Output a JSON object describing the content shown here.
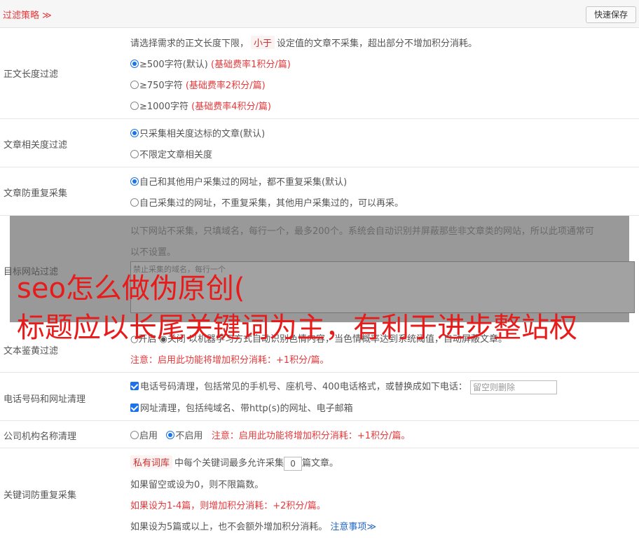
{
  "header": {
    "title": "过滤策略 ≫",
    "save_label": "快速保存"
  },
  "length_filter": {
    "label": "正文长度过滤",
    "desc_pre": "请选择需求的正文长度下限，",
    "desc_tag": "小于",
    "desc_post": "设定值的文章不采集，超出部分不增加积分消耗。",
    "opt1": "≥500字符(默认)",
    "opt1_note": "(基础费率1积分/篇)",
    "opt2": "≥750字符",
    "opt2_note": "(基础费率2积分/篇)",
    "opt3": "≥1000字符",
    "opt3_note": "(基础费率4积分/篇)"
  },
  "relevance": {
    "label": "文章相关度过滤",
    "opt1": "只采集相关度达标的文章(默认)",
    "opt2": "不限定文章相关度"
  },
  "dedupe": {
    "label": "文章防重复采集",
    "opt1": "自己和其他用户采集过的网址，都不重复采集(默认)",
    "opt2": "自己采集过的网址，不重复采集，其他用户采集过的，可以再采。"
  },
  "target_site": {
    "label": "目标网站过滤",
    "desc1": "以下网站不采集，只填域名，每行一个，最多200个。系统会自动识别并屏蔽那些非文章类的网站，所以此项通常可",
    "desc2": "以不设置。",
    "placeholder": "禁止采集的域名，每行一个"
  },
  "porn": {
    "label": "文本鉴黄过滤",
    "line": "○开启  ◉关闭  以机器学习方式自动识别色情内容，当色情概率达到系统阈值，自动屏蔽文章。",
    "note": "注意：启用此功能将增加积分消耗：+1积分/篇。"
  },
  "phone": {
    "label": "电话号码和网址清理",
    "opt1": "电话号码清理，包括常见的手机号、座机号、400电话格式，或替换成如下电话：",
    "input_placeholder": "留空则删除",
    "opt2": "网址清理，包括纯域名、带http(s)的网址、电子邮箱"
  },
  "company": {
    "label": "公司机构名称清理",
    "on": "启用",
    "off": "不启用",
    "note": "注意：启用此功能将增加积分消耗：+1积分/篇。"
  },
  "keyword": {
    "label": "关键词防重复采集",
    "tag": "私有词库",
    "line1_mid": "中每个关键词最多允许采集",
    "value": "0",
    "line1_post": "篇文章。",
    "line2": "如果留空或设为0，则不限篇数。",
    "line3": "如果设为1-4篇，则增加积分消耗：+2积分/篇。",
    "line4": "如果设为5篇或以上，也不会额外增加积分消耗。",
    "link": "注意事项"
  },
  "overlay": {
    "line1": "seo怎么做伪原创(",
    "line2": "标题应以长尾关键词为主，有利于进步整站权"
  },
  "colors": {
    "accent_red": "#e4393c",
    "link_blue": "#2468c4",
    "radio_blue": "#1a73e8"
  }
}
